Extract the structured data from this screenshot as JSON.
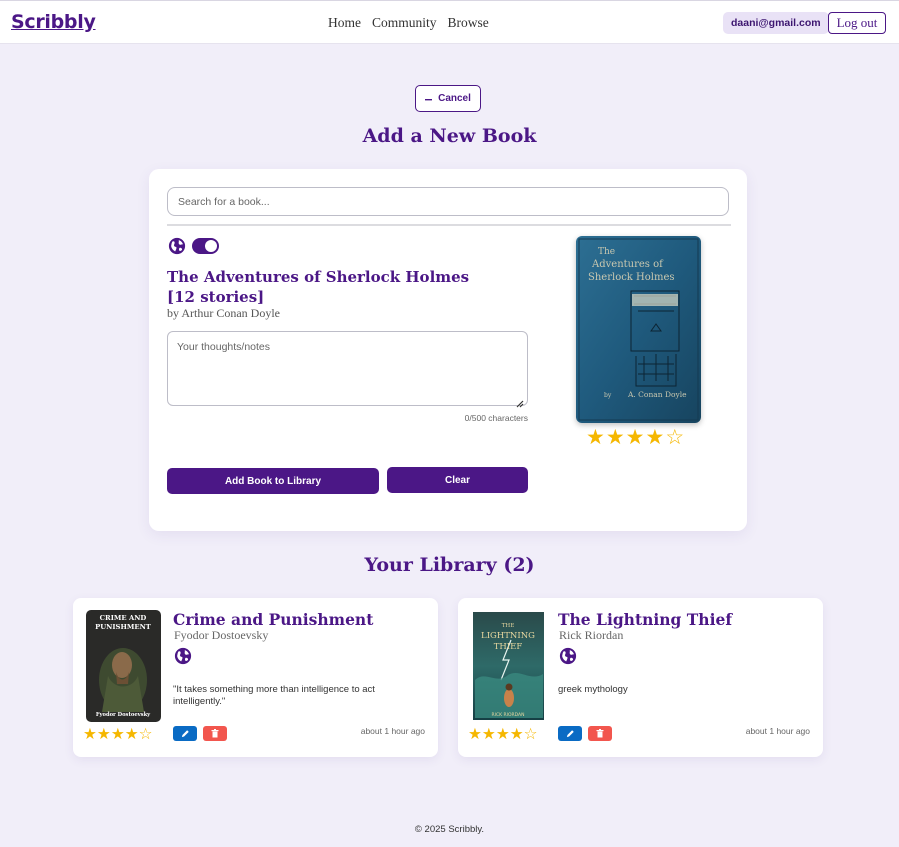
{
  "header": {
    "logo": "Scribbly",
    "nav": [
      "Home",
      "Community",
      "Browse"
    ],
    "user_email": "daani@gmail.com",
    "logout_label": "Log out"
  },
  "cancel_label": "Cancel",
  "add_section": {
    "title": "Add a New Book",
    "search_placeholder": "Search for a book...",
    "public_toggle_on": true,
    "selected_book": {
      "title": "The Adventures of Sherlock Holmes [12 stories]",
      "author": "by Arthur Conan Doyle",
      "cover_title_line1": "The",
      "cover_title_line2": "Adventures of",
      "cover_title_line3": "Sherlock Holmes",
      "cover_author": "A. Conan Doyle",
      "rating": 4,
      "rating_max": 5
    },
    "notes_placeholder": "Your thoughts/notes",
    "char_count": "0/500 characters",
    "add_button": "Add Book to Library",
    "clear_button": "Clear"
  },
  "library": {
    "title": "Your Library (2)",
    "books": [
      {
        "title": "Crime and Punishment",
        "author": "Fyodor Dostoevsky",
        "cover_title": "CRIME AND PUNISHMENT",
        "cover_author": "Fyodor Dostoevsky",
        "note": "\"It takes something more than intelligence to act intelligently.\"",
        "rating": 4,
        "rating_max": 5,
        "time": "about 1 hour ago"
      },
      {
        "title": "The Lightning Thief",
        "author": "Rick Riordan",
        "cover_title": "THE LIGHTNING THIEF",
        "cover_author": "RICK RIORDAN",
        "note": "greek mythology",
        "rating": 4,
        "rating_max": 5,
        "time": "about 1 hour ago"
      }
    ]
  },
  "footer": "© 2025 Scribbly.",
  "colors": {
    "brand": "#4b1786",
    "background": "#f1eef9",
    "star": "#f5b700",
    "edit": "#0a6bc4",
    "delete": "#f2564e"
  }
}
